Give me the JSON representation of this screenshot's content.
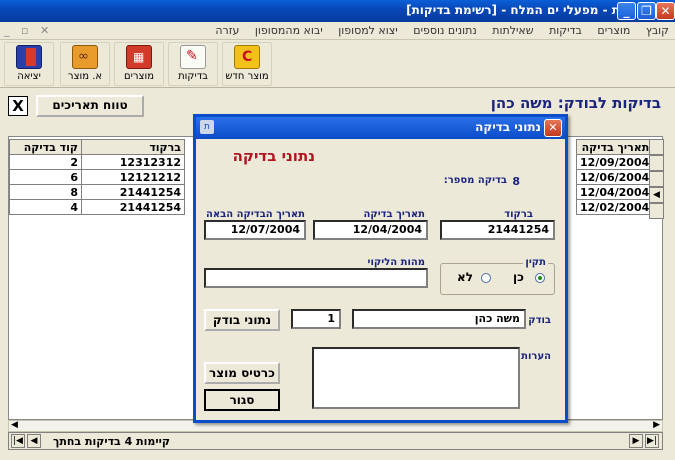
{
  "window": {
    "title": "תאגרית - מפעלי ים המלח - [רשימת בדיקות]",
    "app_icon": "ת"
  },
  "menu": {
    "items": [
      "קובץ",
      "מוצרים",
      "בדיקות",
      "שאילתות",
      "נתונים נוספים",
      "יצוא למסופון",
      "יבוא מהמסופון",
      "עזרה"
    ],
    "mdi_controls": "_ ▫ ✕"
  },
  "toolbar": {
    "buttons": [
      {
        "label": "מוצר חדש",
        "icon": "new-product-icon"
      },
      {
        "label": "בדיקות",
        "icon": "inspections-icon"
      },
      {
        "label": "מוצרים",
        "icon": "products-icon"
      },
      {
        "label": "א. מוצר",
        "icon": "binoculars-icon"
      },
      {
        "label": "יציאה",
        "icon": "exit-door-icon"
      }
    ]
  },
  "header": {
    "title": "בדיקות לבודק: משה כהן",
    "date_range_button": "טווח תאריכים",
    "close_x": "X"
  },
  "grid": {
    "left_columns": [
      "קוד בדיקה",
      "ברקוד"
    ],
    "right_columns": [
      "תאריך בדיקה"
    ],
    "rows": [
      {
        "code": "2",
        "barcode": "12312312",
        "date": "12/09/2004"
      },
      {
        "code": "6",
        "barcode": "12121212",
        "date": "12/06/2004"
      },
      {
        "code": "8",
        "barcode": "21441254",
        "date": "12/04/2004"
      },
      {
        "code": "4",
        "barcode": "21441254",
        "date": "12/02/2004"
      }
    ],
    "selected_row_marker": "◀"
  },
  "navbar": {
    "status": "קיימות 4 בדיקות בחתך",
    "first": "|◀",
    "prev": "◀",
    "next": "▶",
    "last": "▶|"
  },
  "dialog": {
    "title": "נתוני בדיקה",
    "heading": "נתוני בדיקה",
    "inspection_number_label": "בדיקה מספר:",
    "inspection_number": "8",
    "barcode_label": "ברקוד",
    "barcode": "21441254",
    "inspection_date_label": "תאריך בדיקה",
    "inspection_date": "12/04/2004",
    "next_inspection_label": "תאריך הבדיקה הבאה",
    "next_inspection_date": "12/07/2004",
    "valid_label": "תקין",
    "yes_label": "כן",
    "no_label": "לא",
    "defect_label": "מהות הליקוי",
    "defect_value": "",
    "inspector_label": "בודק",
    "inspector_name": "משה כהן",
    "inspector_id": "1",
    "inspector_data_button": "נתוני בודק",
    "notes_label": "הערות",
    "notes_value": "",
    "product_card_button": "כרטיס מוצר",
    "close_button": "סגור"
  }
}
